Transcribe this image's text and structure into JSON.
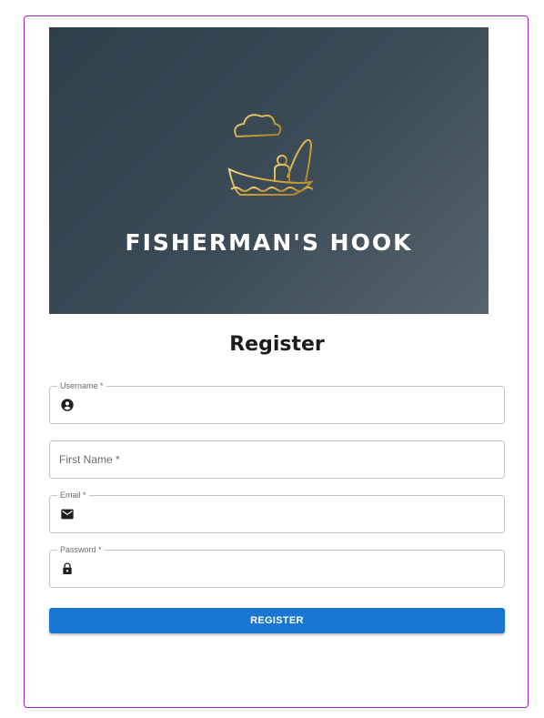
{
  "brand": {
    "name": "FISHERMAN'S HOOK",
    "logo_icon": "fisherman-boat-icon",
    "accent_color": "#d4a93c"
  },
  "form": {
    "title": "Register",
    "fields": [
      {
        "label": "Username *",
        "icon": "account-circle-icon",
        "value": ""
      },
      {
        "label": "First Name *",
        "icon": "",
        "value": ""
      },
      {
        "label": "Email *",
        "icon": "mail-icon",
        "value": ""
      },
      {
        "label": "Password *",
        "icon": "lock-icon",
        "value": ""
      }
    ],
    "submit_label": "REGISTER",
    "submit_color": "#1976d2"
  }
}
